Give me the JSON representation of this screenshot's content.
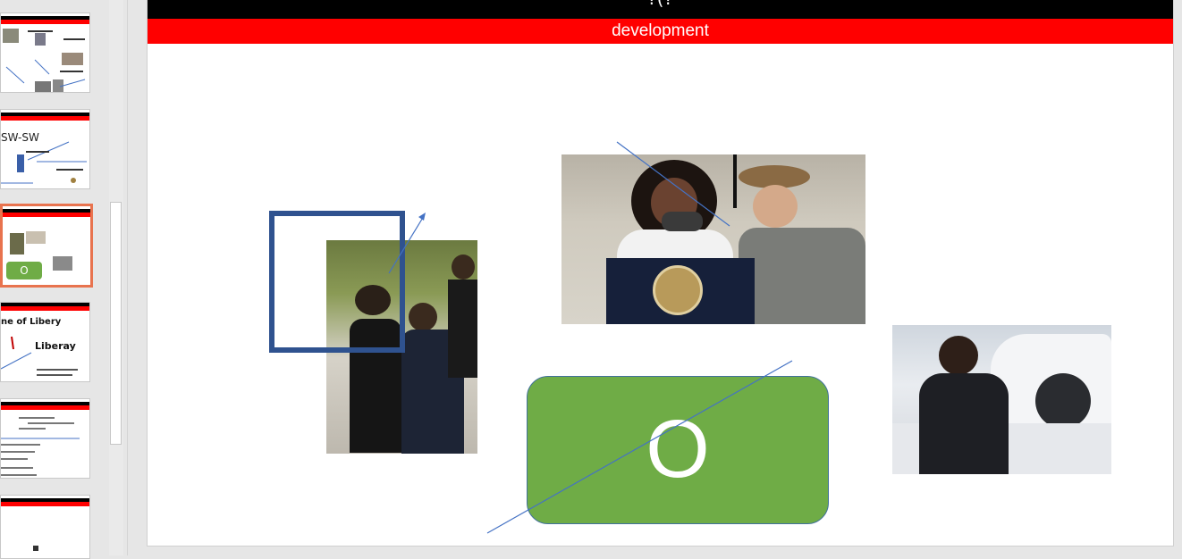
{
  "slide": {
    "title": "?(?",
    "subtitle": "development",
    "shape_text": "O"
  },
  "thumbnails": {
    "t2": {
      "text": "SW-SW"
    },
    "t3": {
      "shape_text": "O"
    },
    "t4": {
      "title": "ne of Libery",
      "label": "Liberay"
    }
  },
  "icons": {
    "arrow": "arrow-up-right-icon"
  },
  "colors": {
    "title_bar": "#000000",
    "subtitle_bar": "#ff0000",
    "green_shape": "#6fac46",
    "selection": "#e8734e",
    "line": "#4472c4",
    "rect": "#2f528f"
  }
}
